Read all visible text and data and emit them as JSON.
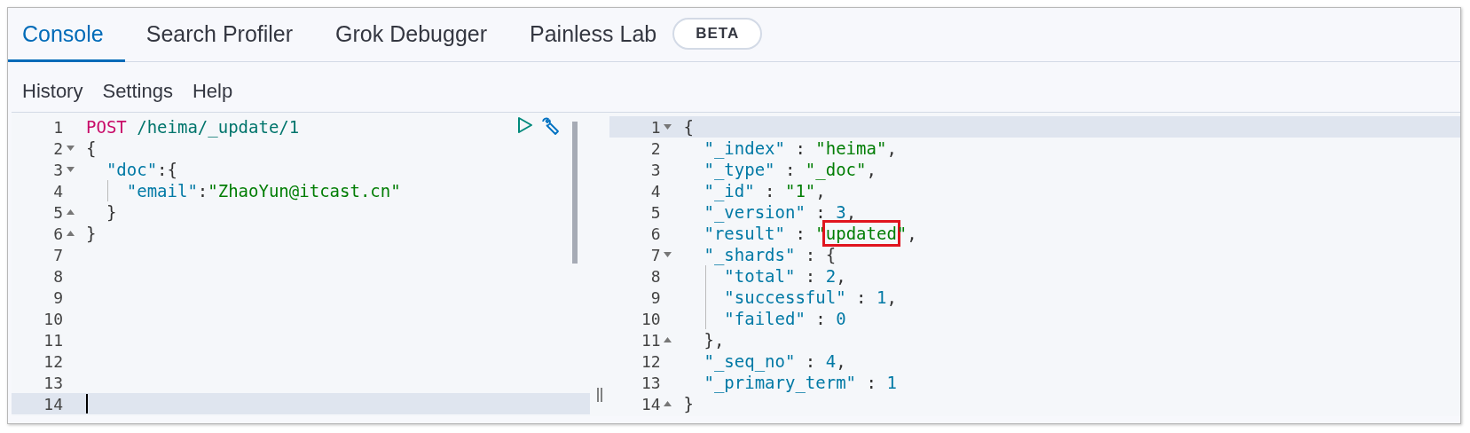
{
  "tabs": [
    {
      "label": "Console",
      "selected": true
    },
    {
      "label": "Search Profiler",
      "selected": false
    },
    {
      "label": "Grok Debugger",
      "selected": false
    },
    {
      "label": "Painless Lab",
      "selected": false,
      "badge": "BETA"
    }
  ],
  "menu": [
    "History",
    "Settings",
    "Help"
  ],
  "request_editor": {
    "focused": true,
    "lines": [
      {
        "number": "1",
        "active": false,
        "segments": [
          {
            "kind": "method",
            "text": "POST"
          },
          {
            "kind": "url",
            "text": " /heima/_update/1"
          }
        ]
      },
      {
        "number": "2",
        "active": false,
        "fold_start": true,
        "segments": [
          {
            "kind": "punct",
            "text": "{"
          }
        ]
      },
      {
        "number": "3",
        "active": false,
        "fold_start": true,
        "segments": [
          {
            "kind": "key",
            "text": "  \"doc\""
          },
          {
            "kind": "punct",
            "text": ":{"
          }
        ]
      },
      {
        "number": "4",
        "active": false,
        "guide": true,
        "segments": [
          {
            "kind": "key",
            "text": "    \"email\""
          },
          {
            "kind": "punct",
            "text": ":"
          },
          {
            "kind": "string",
            "text": "\"ZhaoYun@itcast.cn\""
          }
        ]
      },
      {
        "number": "5",
        "active": false,
        "fold_end": true,
        "segments": [
          {
            "kind": "punct",
            "text": "  }"
          }
        ]
      },
      {
        "number": "6",
        "active": false,
        "fold_end": true,
        "segments": [
          {
            "kind": "punct",
            "text": "}"
          }
        ]
      },
      {
        "number": "7",
        "active": false
      },
      {
        "number": "8",
        "active": false
      },
      {
        "number": "9",
        "active": false
      },
      {
        "number": "10",
        "active": false
      },
      {
        "number": "11",
        "active": false
      },
      {
        "number": "12",
        "active": false
      },
      {
        "number": "13",
        "active": false
      },
      {
        "number": "14",
        "active": true
      }
    ]
  },
  "response_editor": {
    "focused": false,
    "lines": [
      {
        "number": "1",
        "active": true,
        "fold_start": true,
        "segments": [
          {
            "kind": "punct",
            "text": "{"
          }
        ]
      },
      {
        "number": "2",
        "active": false,
        "segments": [
          {
            "kind": "key",
            "text": "  \"_index\""
          },
          {
            "kind": "punct",
            "text": " : "
          },
          {
            "kind": "string",
            "text": "\"heima\""
          },
          {
            "kind": "punct",
            "text": ","
          }
        ]
      },
      {
        "number": "3",
        "active": false,
        "segments": [
          {
            "kind": "key",
            "text": "  \"_type\""
          },
          {
            "kind": "punct",
            "text": " : "
          },
          {
            "kind": "string",
            "text": "\"_doc\""
          },
          {
            "kind": "punct",
            "text": ","
          }
        ]
      },
      {
        "number": "4",
        "active": false,
        "segments": [
          {
            "kind": "key",
            "text": "  \"_id\""
          },
          {
            "kind": "punct",
            "text": " : "
          },
          {
            "kind": "string",
            "text": "\"1\""
          },
          {
            "kind": "punct",
            "text": ","
          }
        ]
      },
      {
        "number": "5",
        "active": false,
        "segments": [
          {
            "kind": "key",
            "text": "  \"_version\""
          },
          {
            "kind": "punct",
            "text": " : "
          },
          {
            "kind": "number",
            "text": "3"
          },
          {
            "kind": "punct",
            "text": ","
          }
        ]
      },
      {
        "number": "6",
        "active": false,
        "segments": [
          {
            "kind": "key",
            "text": "  \"result\""
          },
          {
            "kind": "punct",
            "text": " : "
          },
          {
            "kind": "string",
            "text": "\""
          },
          {
            "kind": "string",
            "text": "updated",
            "boxed": true
          },
          {
            "kind": "string",
            "text": "\""
          },
          {
            "kind": "punct",
            "text": ","
          }
        ]
      },
      {
        "number": "7",
        "active": false,
        "fold_start": true,
        "segments": [
          {
            "kind": "key",
            "text": "  \"_shards\""
          },
          {
            "kind": "punct",
            "text": " : {"
          }
        ]
      },
      {
        "number": "8",
        "active": false,
        "guide": true,
        "segments": [
          {
            "kind": "key",
            "text": "    \"total\""
          },
          {
            "kind": "punct",
            "text": " : "
          },
          {
            "kind": "number",
            "text": "2"
          },
          {
            "kind": "punct",
            "text": ","
          }
        ]
      },
      {
        "number": "9",
        "active": false,
        "guide": true,
        "segments": [
          {
            "kind": "key",
            "text": "    \"successful\""
          },
          {
            "kind": "punct",
            "text": " : "
          },
          {
            "kind": "number",
            "text": "1"
          },
          {
            "kind": "punct",
            "text": ","
          }
        ]
      },
      {
        "number": "10",
        "active": false,
        "guide": true,
        "segments": [
          {
            "kind": "key",
            "text": "    \"failed\""
          },
          {
            "kind": "punct",
            "text": " : "
          },
          {
            "kind": "number",
            "text": "0"
          }
        ]
      },
      {
        "number": "11",
        "active": false,
        "fold_end": true,
        "segments": [
          {
            "kind": "punct",
            "text": "  },"
          }
        ]
      },
      {
        "number": "12",
        "active": false,
        "segments": [
          {
            "kind": "key",
            "text": "  \"_seq_no\""
          },
          {
            "kind": "punct",
            "text": " : "
          },
          {
            "kind": "number",
            "text": "4"
          },
          {
            "kind": "punct",
            "text": ","
          }
        ]
      },
      {
        "number": "13",
        "active": false,
        "segments": [
          {
            "kind": "key",
            "text": "  \"_primary_term\""
          },
          {
            "kind": "punct",
            "text": " : "
          },
          {
            "kind": "number",
            "text": "1"
          }
        ]
      },
      {
        "number": "14",
        "active": false,
        "fold_end": true,
        "segments": [
          {
            "kind": "punct",
            "text": "}"
          }
        ]
      }
    ]
  }
}
